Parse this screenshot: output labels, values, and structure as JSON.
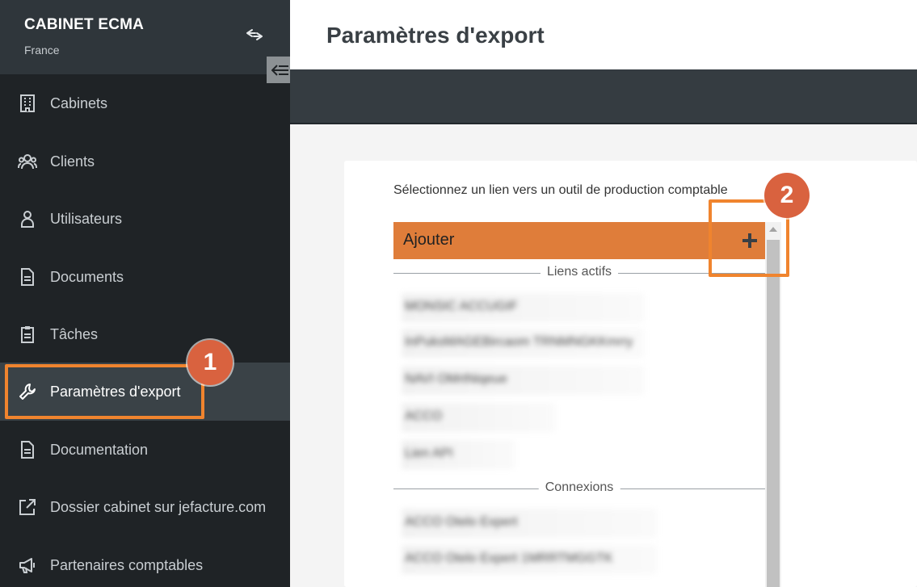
{
  "sidebar": {
    "org_name": "CABINET ECMA",
    "org_country": "France",
    "items": [
      {
        "label": "Cabinets",
        "icon": "building-icon"
      },
      {
        "label": "Clients",
        "icon": "users-icon"
      },
      {
        "label": "Utilisateurs",
        "icon": "user-icon"
      },
      {
        "label": "Documents",
        "icon": "document-icon"
      },
      {
        "label": "Tâches",
        "icon": "clipboard-icon"
      },
      {
        "label": "Paramètres d'export",
        "icon": "wrench-icon",
        "active": true
      },
      {
        "label": "Documentation",
        "icon": "document-icon"
      },
      {
        "label": "Dossier cabinet sur jefacture.com",
        "icon": "external-link-icon"
      },
      {
        "label": "Partenaires comptables",
        "icon": "megaphone-icon"
      }
    ]
  },
  "header": {
    "title": "Paramètres d'export"
  },
  "main": {
    "description": "Sélectionnez un lien vers un outil de production comptable",
    "add_label": "Ajouter",
    "sections": [
      {
        "title": "Liens actifs",
        "items": [
          "MONSIC ACCUGIF",
          "InPuksMAGEBircaom TRNMNGKKmrry",
          "NAVI OMrtNiqeue",
          "ACCO",
          "Lien API"
        ]
      },
      {
        "title": "Connexions",
        "items": [
          "ACCO Otelo Expert",
          "ACCO Otelo Expert 1MRRTMGGTK"
        ]
      }
    ]
  },
  "annotations": {
    "step1": "1",
    "step2": "2"
  },
  "colors": {
    "accent": "#df7d3a",
    "highlight": "#f0842e",
    "badge": "#d9623f",
    "sidebar_bg": "#1f2326"
  }
}
